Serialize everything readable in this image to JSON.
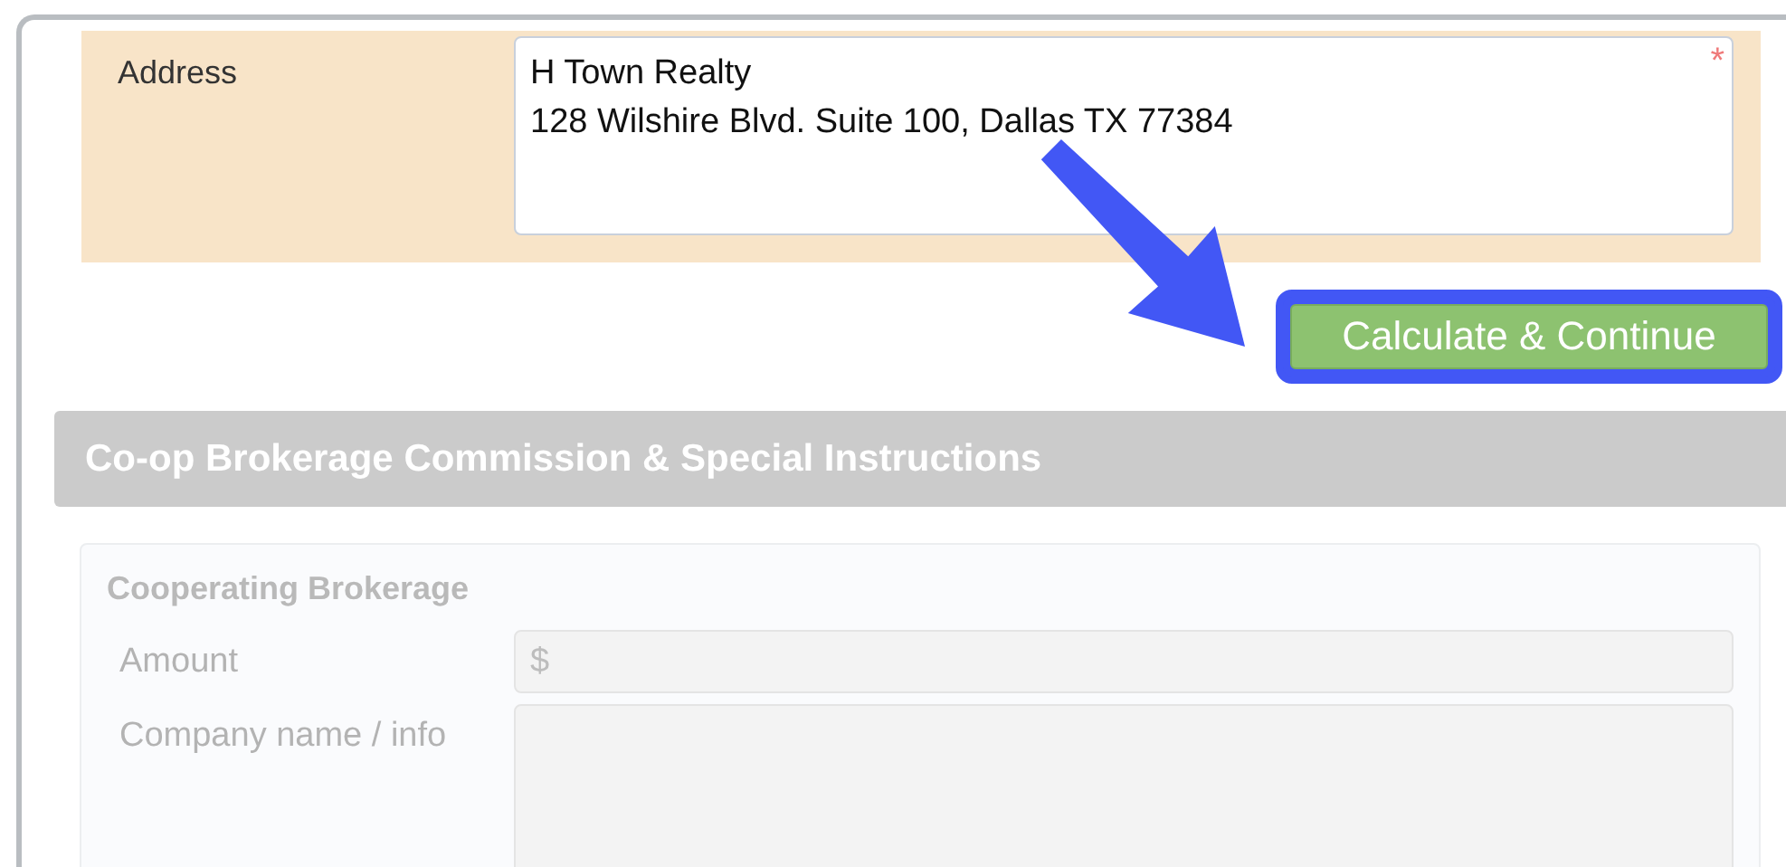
{
  "address": {
    "label": "Address",
    "required_mark": "*",
    "value": "H Town Realty\n128 Wilshire Blvd. Suite 100, Dallas TX 77384"
  },
  "primary_button": {
    "label": "Calculate & Continue",
    "highlighted": true
  },
  "section": {
    "title": "Co-op Brokerage Commission & Special Instructions",
    "card": {
      "title": "Cooperating Brokerage",
      "fields": [
        {
          "label": "Amount",
          "kind": "input",
          "placeholder": "$",
          "disabled": true
        },
        {
          "label": "Company name / info",
          "kind": "textarea",
          "disabled": true
        }
      ]
    }
  }
}
